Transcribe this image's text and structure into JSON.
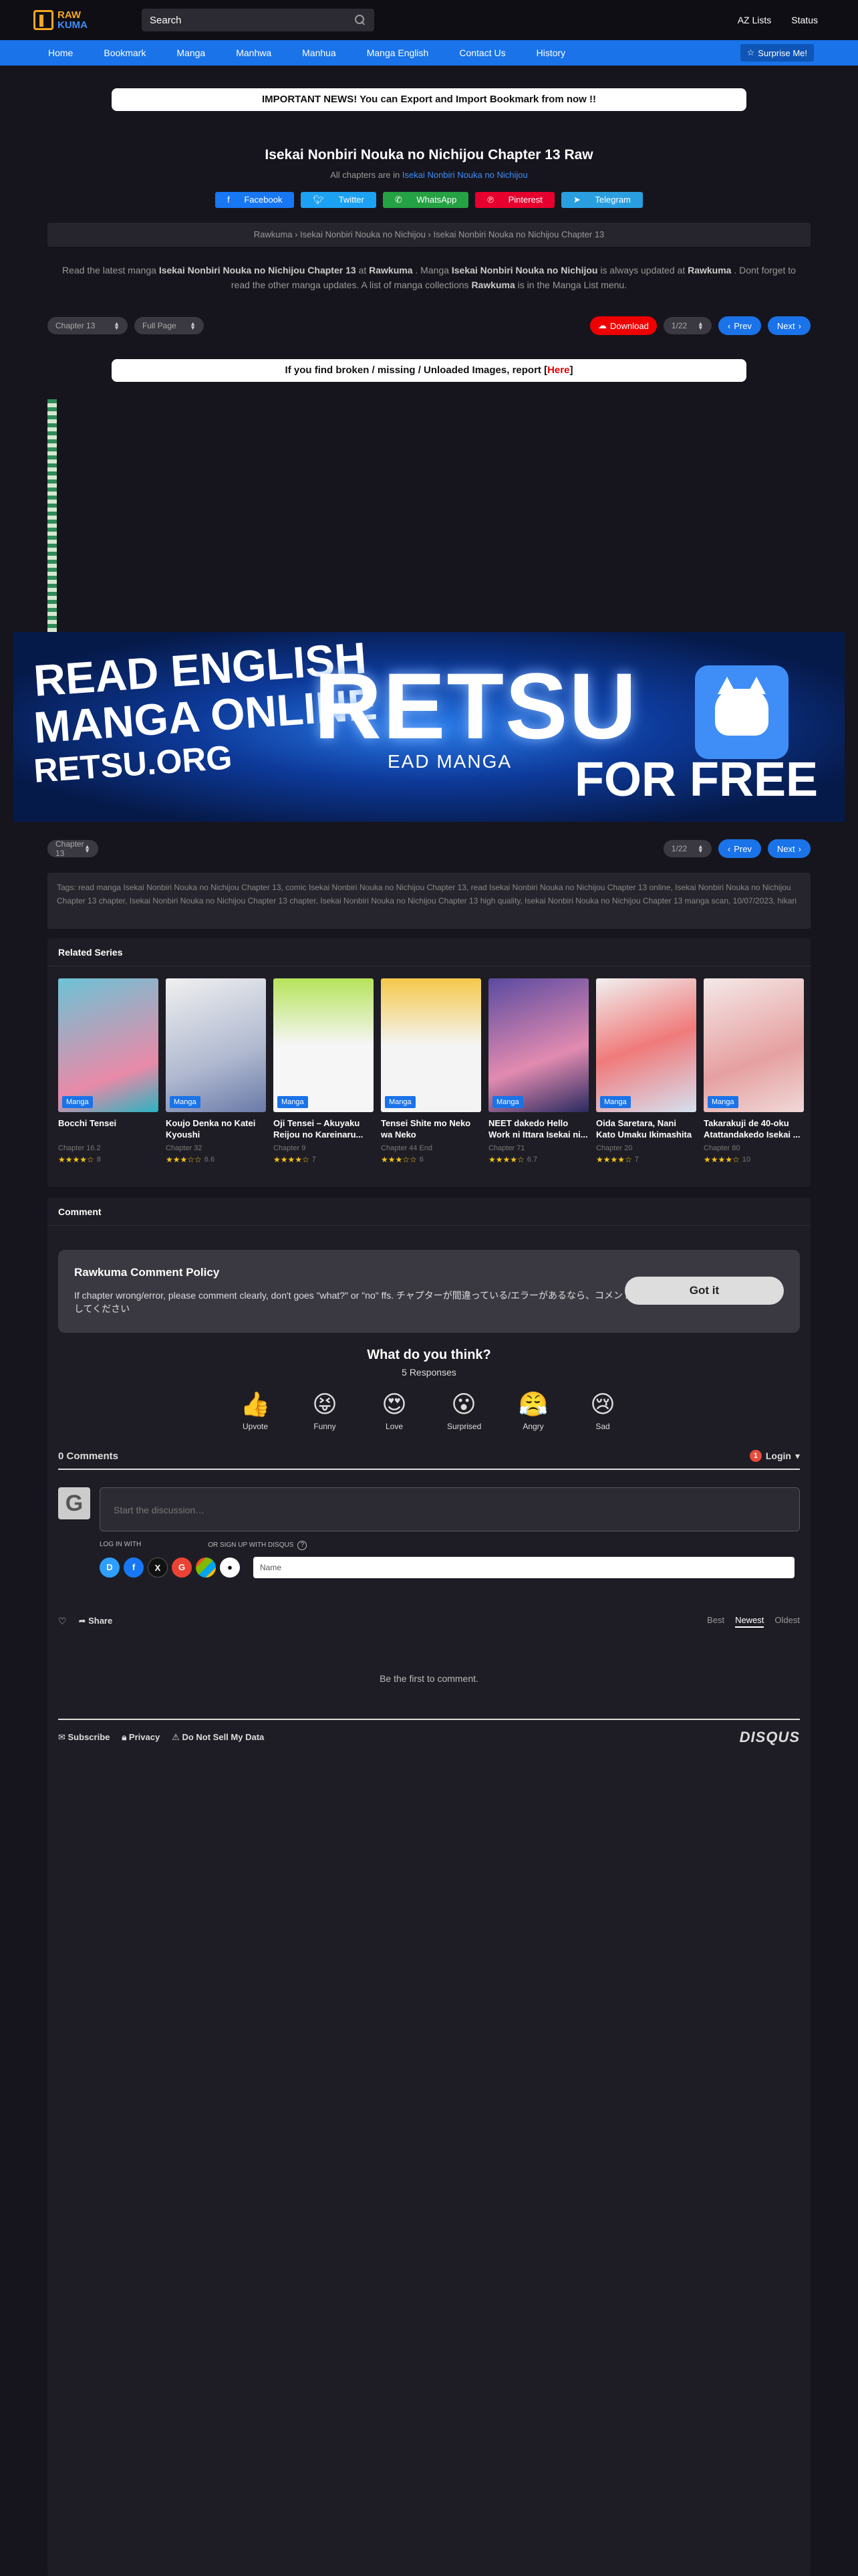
{
  "header": {
    "logo_top": "RAW",
    "logo_bottom": "KUMA",
    "search_placeholder": "Search",
    "links": [
      "AZ Lists",
      "Status"
    ]
  },
  "nav": {
    "items": [
      "Home",
      "Bookmark",
      "Manga",
      "Manhwa",
      "Manhua",
      "Manga English",
      "Contact Us",
      "History"
    ],
    "surprise": "Surprise Me!"
  },
  "news": "IMPORTANT NEWS! You can Export and Import Bookmark from now !!",
  "chapter": {
    "title": "Isekai Nonbiri Nouka no Nichijou Chapter 13 Raw",
    "all_chapters_prefix": "All chapters are in ",
    "series_link": "Isekai Nonbiri Nouka no Nichijou",
    "share": [
      "Facebook",
      "Twitter",
      "WhatsApp",
      "Pinterest",
      "Telegram"
    ],
    "breadcrumb": "Rawkuma › Isekai Nonbiri Nouka no Nichijou › Isekai Nonbiri Nouka no Nichijou Chapter 13",
    "desc_1": "Read the latest manga ",
    "desc_bold_1": "Isekai Nonbiri Nouka no Nichijou Chapter 13",
    "desc_2": " at ",
    "desc_bold_2": "Rawkuma",
    "desc_3": " . Manga ",
    "desc_bold_3": "Isekai Nonbiri Nouka no Nichijou",
    "desc_4": " is always updated at ",
    "desc_bold_4": "Rawkuma",
    "desc_5": " . Dont forget to read the other manga updates. A list of manga collections ",
    "desc_bold_5": "Rawkuma",
    "desc_6": " is in the Manga List menu."
  },
  "controls": {
    "chapter_select": "Chapter 13",
    "mode_select": "Full Page",
    "download": "Download",
    "page_select": "1/22",
    "prev": "Prev",
    "next": "Next"
  },
  "report": {
    "text_before": "If you find broken / missing / Unloaded Images, report [",
    "here": "Here",
    "text_after": "]"
  },
  "banner": {
    "line1": "READ ENGLISH",
    "line2": "MANGA ONLINE",
    "line3": "RETSU.ORG",
    "brand": "RETSU",
    "sub": "EAD MANGA",
    "free": "FOR FREE"
  },
  "tags": "Tags: read manga Isekai Nonbiri Nouka no Nichijou Chapter 13, comic Isekai Nonbiri Nouka no Nichijou Chapter 13, read Isekai Nonbiri Nouka no Nichijou Chapter 13 online, Isekai Nonbiri Nouka no Nichijou Chapter 13 chapter, Isekai Nonbiri Nouka no Nichijou Chapter 13 chapter, Isekai Nonbiri Nouka no Nichijou Chapter 13 high quality, Isekai Nonbiri Nouka no Nichijou Chapter 13 manga scan, 10/07/2023, hikari",
  "related": {
    "heading": "Related Series",
    "items": [
      {
        "title": "Bocchi Tensei",
        "chapter": "Chapter 16.2",
        "stars": "★★★★☆",
        "rating": "8",
        "badge": "Manga"
      },
      {
        "title": "Koujo Denka no Katei Kyoushi",
        "chapter": "Chapter 32",
        "stars": "★★★☆☆",
        "rating": "6.6",
        "badge": "Manga"
      },
      {
        "title": "Oji Tensei – Akuyaku Reijou no Kareinaru...",
        "chapter": "Chapter 9",
        "stars": "★★★★☆",
        "rating": "7",
        "badge": "Manga"
      },
      {
        "title": "Tensei Shite mo Neko wa Neko",
        "chapter": "Chapter 44 End",
        "stars": "★★★☆☆",
        "rating": "6",
        "badge": "Manga"
      },
      {
        "title": "NEET dakedo Hello Work ni Ittara Isekai ni...",
        "chapter": "Chapter 71",
        "stars": "★★★★☆",
        "rating": "6.7",
        "badge": "Manga"
      },
      {
        "title": "Oida Saretara, Nani Kato Umaku Ikimashita",
        "chapter": "Chapter 20",
        "stars": "★★★★☆",
        "rating": "7",
        "badge": "Manga"
      },
      {
        "title": "Takarakuji de 40-oku Atattandakedo Isekai ...",
        "chapter": "Chapter 80",
        "stars": "★★★★☆",
        "rating": "10",
        "badge": "Manga"
      }
    ]
  },
  "comments": {
    "heading": "Comment",
    "policy_title": "Rawkuma Comment Policy",
    "policy_text": "If chapter wrong/error, please comment clearly, don't goes \"what?\" or \"no\" ffs. チャプターが間違っている/エラーがあるなら、コメントしてください",
    "got_it": "Got it",
    "question": "What do you think?",
    "responses": "5 Responses",
    "reactions": [
      {
        "emoji": "👍",
        "label": "Upvote"
      },
      {
        "emoji": "😝",
        "label": "Funny"
      },
      {
        "emoji": "😍",
        "label": "Love"
      },
      {
        "emoji": "😮",
        "label": "Surprised"
      },
      {
        "emoji": "😤",
        "label": "Angry"
      },
      {
        "emoji": "😢",
        "label": "Sad"
      }
    ],
    "count": "0 Comments",
    "login": "Login",
    "login_badge": "1",
    "avatar_letter": "G",
    "placeholder": "Start the discussion…",
    "login_with": "LOG IN WITH",
    "signup": "OR SIGN UP WITH DISQUS",
    "name_placeholder": "Name",
    "share": "Share",
    "sort": [
      "Best",
      "Newest",
      "Oldest"
    ],
    "empty": "Be the first to comment.",
    "footer": [
      "Subscribe",
      "Privacy",
      "Do Not Sell My Data"
    ],
    "brand": "DISQUS"
  }
}
